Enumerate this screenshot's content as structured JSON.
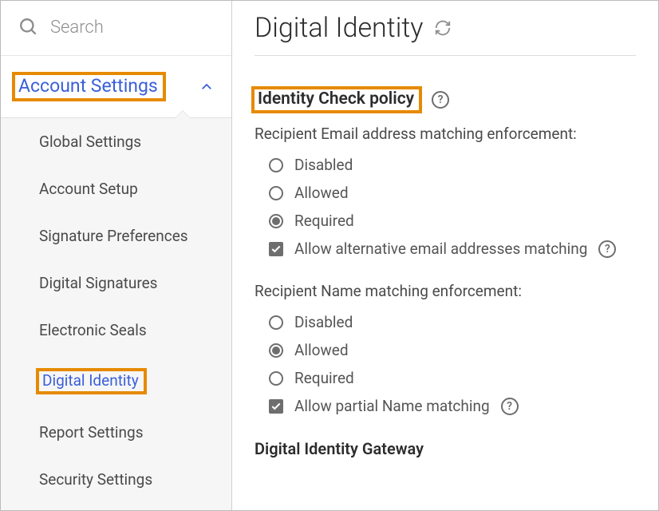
{
  "search": {
    "placeholder": "Search"
  },
  "sidebar": {
    "section_title": "Account Settings",
    "items": [
      {
        "label": "Global Settings"
      },
      {
        "label": "Account Setup"
      },
      {
        "label": "Signature Preferences"
      },
      {
        "label": "Digital Signatures"
      },
      {
        "label": "Electronic Seals"
      },
      {
        "label": "Digital Identity"
      },
      {
        "label": "Report Settings"
      },
      {
        "label": "Security Settings"
      }
    ]
  },
  "main": {
    "page_title": "Digital Identity",
    "identity_section_title": "Identity Check policy",
    "email_group_label": "Recipient Email address matching enforcement:",
    "email_options": {
      "disabled": "Disabled",
      "allowed": "Allowed",
      "required": "Required"
    },
    "email_allow_alt": "Allow alternative email addresses matching",
    "name_group_label": "Recipient Name matching enforcement:",
    "name_options": {
      "disabled": "Disabled",
      "allowed": "Allowed",
      "required": "Required"
    },
    "name_allow_partial": "Allow partial Name matching",
    "gateway_heading": "Digital Identity Gateway"
  }
}
